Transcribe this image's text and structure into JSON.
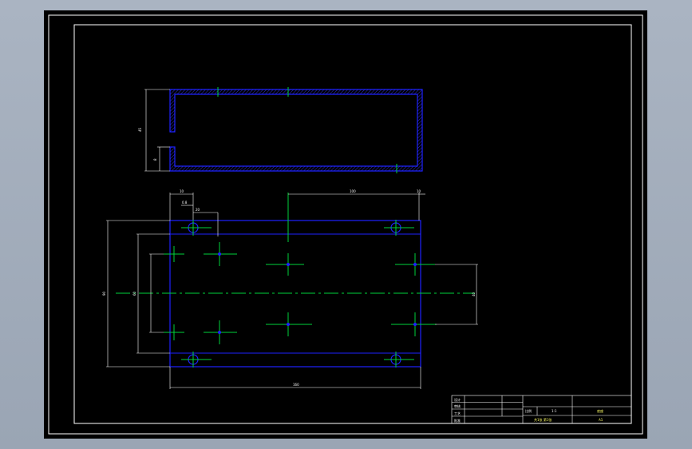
{
  "drawing": {
    "title_block": {
      "rows_left": [
        "设计",
        "审核",
        "工艺",
        "批准"
      ],
      "scale_label": "比例",
      "scale_value": "1:1",
      "part_name": "底座",
      "sheet_label": "共1张 第1张",
      "number": "A1"
    },
    "dimensions": {
      "top_height": "45",
      "top_small": "8",
      "top_left_d1": "10",
      "top_left_d2": "0.8",
      "top_left_d3": "20",
      "top_span": "100",
      "top_right": "10",
      "left_outer": "90",
      "left_inner": "60",
      "right_height": "40",
      "bottom_width": "160"
    },
    "colors": {
      "outline": "#1e22ff",
      "centerline": "#00d23c",
      "dimension": "#ffffff",
      "background": "#000000"
    }
  }
}
